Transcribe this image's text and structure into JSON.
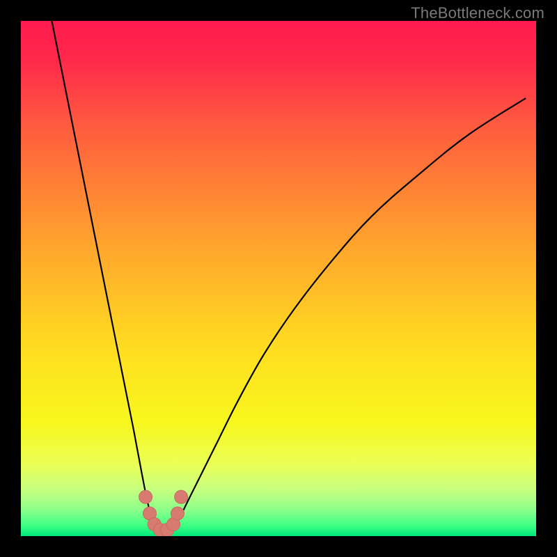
{
  "watermark": "TheBottleneck.com",
  "colors": {
    "frame": "#000000",
    "curve_stroke": "#000000",
    "marker_fill": "#d77a6f",
    "marker_stroke": "#c96a60",
    "gradient_stops": [
      {
        "offset": 0.0,
        "color": "#ff1a4d"
      },
      {
        "offset": 0.08,
        "color": "#ff2a4a"
      },
      {
        "offset": 0.2,
        "color": "#ff5a3f"
      },
      {
        "offset": 0.35,
        "color": "#ff8a33"
      },
      {
        "offset": 0.5,
        "color": "#ffb728"
      },
      {
        "offset": 0.65,
        "color": "#ffe01f"
      },
      {
        "offset": 0.78,
        "color": "#f7f71e"
      },
      {
        "offset": 0.86,
        "color": "#eaff55"
      },
      {
        "offset": 0.91,
        "color": "#c7ff80"
      },
      {
        "offset": 0.95,
        "color": "#8aff8a"
      },
      {
        "offset": 0.98,
        "color": "#3cff84"
      },
      {
        "offset": 1.0,
        "color": "#00e87a"
      }
    ]
  },
  "chart_data": {
    "type": "line",
    "title": "",
    "xlabel": "",
    "ylabel": "",
    "xlim": [
      0,
      100
    ],
    "ylim": [
      0,
      100
    ],
    "series": [
      {
        "name": "left-branch",
        "x": [
          6,
          8,
          10,
          12,
          14,
          16,
          18,
          20,
          22,
          23.5,
          24.5,
          25.5,
          26.5
        ],
        "y": [
          100,
          90,
          80,
          70,
          60,
          50,
          40,
          30,
          20,
          12,
          7,
          3,
          0.8
        ]
      },
      {
        "name": "right-branch",
        "x": [
          29,
          30.5,
          32.5,
          35,
          38,
          42,
          47,
          53,
          60,
          68,
          77,
          87,
          98
        ],
        "y": [
          0.8,
          3,
          7,
          12,
          18,
          26,
          35,
          44,
          53,
          62,
          70,
          78,
          85
        ]
      }
    ],
    "markers": {
      "name": "valley-points",
      "x": [
        24.2,
        25.0,
        25.9,
        27.0,
        28.4,
        29.6,
        30.4,
        31.1
      ],
      "y": [
        7.6,
        4.4,
        2.3,
        1.2,
        1.2,
        2.3,
        4.4,
        7.6
      ]
    },
    "annotations": []
  }
}
